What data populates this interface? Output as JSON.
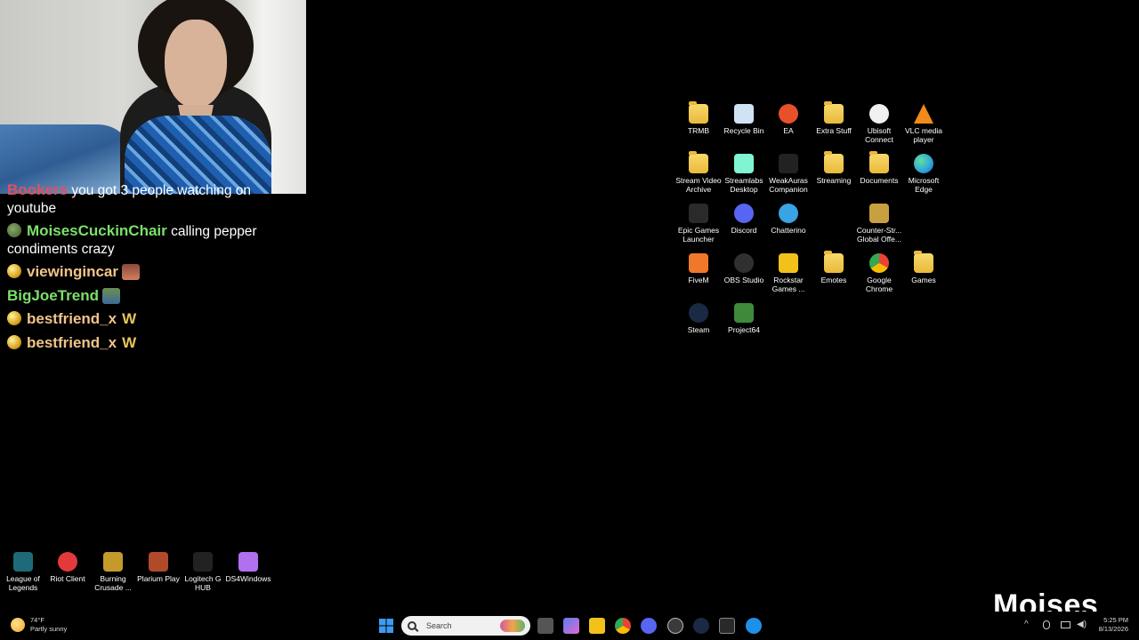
{
  "chat": [
    {
      "user": "Bookers",
      "user_color": "#e05060",
      "text": "you got 3 people watching on youtube",
      "badge": "none"
    },
    {
      "user": "MoisesCuckinChair",
      "user_color": "#7be06a",
      "text": "calling pepper condiments crazy",
      "badge": "frog"
    },
    {
      "user": "viewingincar",
      "user_color": "#f2c48a",
      "text": "",
      "badge": "gold",
      "emote": "face-emote"
    },
    {
      "user": "BigJoeTrend",
      "user_color": "#7be06a",
      "text": "",
      "badge": "none",
      "emote": "people-emote"
    },
    {
      "user": "bestfriend_x",
      "user_color": "#f2c48a",
      "text": "W",
      "badge": "gold"
    },
    {
      "user": "bestfriend_x",
      "user_color": "#f2c48a",
      "text": "W",
      "badge": "gold"
    }
  ],
  "desktop_icons": [
    {
      "label": "TRMB",
      "icon": "folder-icon",
      "color": "#e9b93a"
    },
    {
      "label": "Recycle Bin",
      "icon": "recycle-bin-icon",
      "color": "#cfe3f5"
    },
    {
      "label": "EA",
      "icon": "ea-icon",
      "color": "#e8502a"
    },
    {
      "label": "Extra Stuff",
      "icon": "folder-icon",
      "color": "#e9b93a"
    },
    {
      "label": "Ubisoft Connect",
      "icon": "ubisoft-icon",
      "color": "#f0f0f0"
    },
    {
      "label": "VLC media player",
      "icon": "vlc-icon",
      "color": "#f08a1a"
    },
    {
      "label": "Stream Video Archive",
      "icon": "folder-icon",
      "color": "#e9b93a"
    },
    {
      "label": "Streamlabs Desktop",
      "icon": "streamlabs-icon",
      "color": "#80f5d2"
    },
    {
      "label": "WeakAuras Companion",
      "icon": "weakauras-icon",
      "color": "#222222"
    },
    {
      "label": "Streaming",
      "icon": "folder-icon",
      "color": "#e9b93a"
    },
    {
      "label": "Documents",
      "icon": "folder-icon",
      "color": "#e9b93a"
    },
    {
      "label": "Microsoft Edge",
      "icon": "edge-icon",
      "color": "#2fa3d8"
    },
    {
      "label": "Epic Games Launcher",
      "icon": "epic-games-icon",
      "color": "#2a2a2a"
    },
    {
      "label": "Discord",
      "icon": "discord-icon",
      "color": "#5865f2"
    },
    {
      "label": "Chatterino",
      "icon": "chatterino-icon",
      "color": "#3aa3e3"
    },
    {
      "label": "Counter-Str... Global Offe...",
      "icon": "csgo-icon",
      "color": "#c8a040"
    },
    {
      "label": "FiveM",
      "icon": "fivem-icon",
      "color": "#f0782a"
    },
    {
      "label": "OBS Studio",
      "icon": "obs-icon",
      "color": "#303030"
    },
    {
      "label": "Rockstar Games ...",
      "icon": "rockstar-icon",
      "color": "#f2c21a"
    },
    {
      "label": "Emotes",
      "icon": "folder-icon",
      "color": "#e9b93a"
    },
    {
      "label": "Google Chrome",
      "icon": "chrome-icon",
      "color": "#ea4335"
    },
    {
      "label": "Games",
      "icon": "folder-icon",
      "color": "#e9b93a"
    },
    {
      "label": "Steam",
      "icon": "steam-icon",
      "color": "#1b2a44"
    },
    {
      "label": "Project64",
      "icon": "project64-icon",
      "color": "#3e8a3a"
    },
    {
      "label": "League of Legends",
      "icon": "league-icon",
      "color": "#1e6a78"
    },
    {
      "label": "Riot Client",
      "icon": "riot-icon",
      "color": "#e23a3a"
    },
    {
      "label": "Burning Crusade ...",
      "icon": "wow-icon",
      "color": "#c49a2a"
    },
    {
      "label": "Plarium Play",
      "icon": "plarium-icon",
      "color": "#b04a2a"
    },
    {
      "label": "Logitech G HUB",
      "icon": "logitech-icon",
      "color": "#222222"
    },
    {
      "label": "DS4Windows",
      "icon": "gamepad-icon",
      "color": "#b070f0"
    }
  ],
  "watermark": "Moises",
  "taskbar": {
    "weather_temp": "74°F",
    "weather_desc": "Partly sunny",
    "search_placeholder": "Search",
    "apps": [
      {
        "name": "start-icon",
        "color": "#2f8cf0"
      },
      {
        "name": "task-view-icon",
        "color": "#cccccc"
      },
      {
        "name": "copilot-icon",
        "color": "#6a8cf0"
      },
      {
        "name": "file-explorer-icon",
        "color": "#f2c21a"
      },
      {
        "name": "chrome-icon",
        "color": "#ea4335"
      },
      {
        "name": "discord-icon",
        "color": "#5865f2"
      },
      {
        "name": "obs-icon",
        "color": "#505050"
      },
      {
        "name": "steam-icon",
        "color": "#1b2a44"
      },
      {
        "name": "epic-games-icon",
        "color": "#2a2a2a"
      },
      {
        "name": "battlenet-icon",
        "color": "#1e90e8"
      }
    ],
    "time": "5:25 PM",
    "date": "8/13/2026"
  }
}
